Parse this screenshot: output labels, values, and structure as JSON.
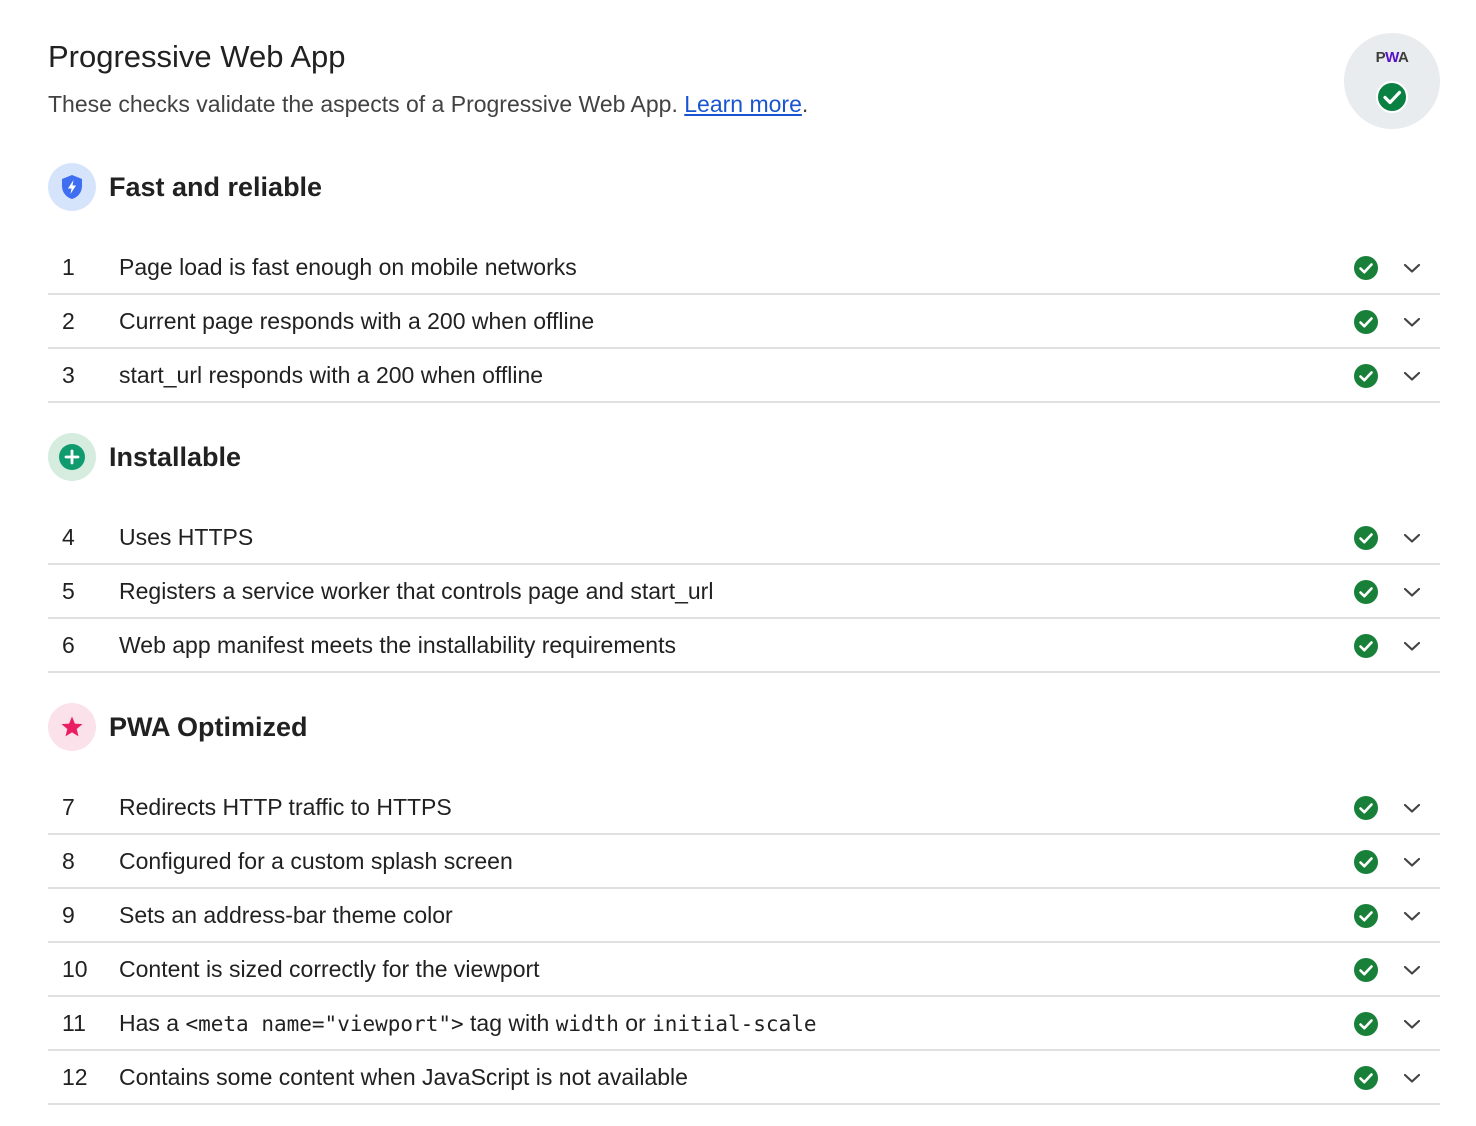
{
  "header": {
    "title": "Progressive Web App",
    "description": "These checks validate the aspects of a Progressive Web App.",
    "learn_more": "Learn more",
    "period": "."
  },
  "badge": {
    "label": "PWA",
    "status_icon": "check-circle-icon",
    "colors": {
      "pass": "#0b8043",
      "badge_bg": "#e9ecee"
    }
  },
  "colors": {
    "link": "#1a55d0",
    "pass": "#188038",
    "divider": "#e0e0e0"
  },
  "groups": [
    {
      "title": "Fast and reliable",
      "icon": "shield-bolt-icon",
      "icon_bg": "#d6e4fb",
      "icon_color": "#3f6ff0",
      "audits": [
        {
          "num": "1",
          "title": "Page load is fast enough on mobile networks"
        },
        {
          "num": "2",
          "title": "Current page responds with a 200 when offline"
        },
        {
          "num": "3",
          "title": "start_url responds with a 200 when offline"
        }
      ]
    },
    {
      "title": "Installable",
      "icon": "plus-circle-icon",
      "icon_bg": "#d5ecdf",
      "icon_color": "#0f9b6e",
      "audits": [
        {
          "num": "4",
          "title": "Uses HTTPS"
        },
        {
          "num": "5",
          "title": "Registers a service worker that controls page and start_url"
        },
        {
          "num": "6",
          "title": "Web app manifest meets the installability requirements"
        }
      ]
    },
    {
      "title": "PWA Optimized",
      "icon": "star-icon",
      "icon_bg": "#fbe2ea",
      "icon_color": "#e91e63",
      "audits": [
        {
          "num": "7",
          "title": "Redirects HTTP traffic to HTTPS"
        },
        {
          "num": "8",
          "title": "Configured for a custom splash screen"
        },
        {
          "num": "9",
          "title": "Sets an address-bar theme color"
        },
        {
          "num": "10",
          "title": "Content is sized correctly for the viewport"
        },
        {
          "num": "11",
          "title_parts": [
            "Has a ",
            "<meta name=\"viewport\">",
            " tag with ",
            "width",
            " or ",
            "initial-scale"
          ]
        },
        {
          "num": "12",
          "title": "Contains some content when JavaScript is not available"
        }
      ]
    }
  ]
}
